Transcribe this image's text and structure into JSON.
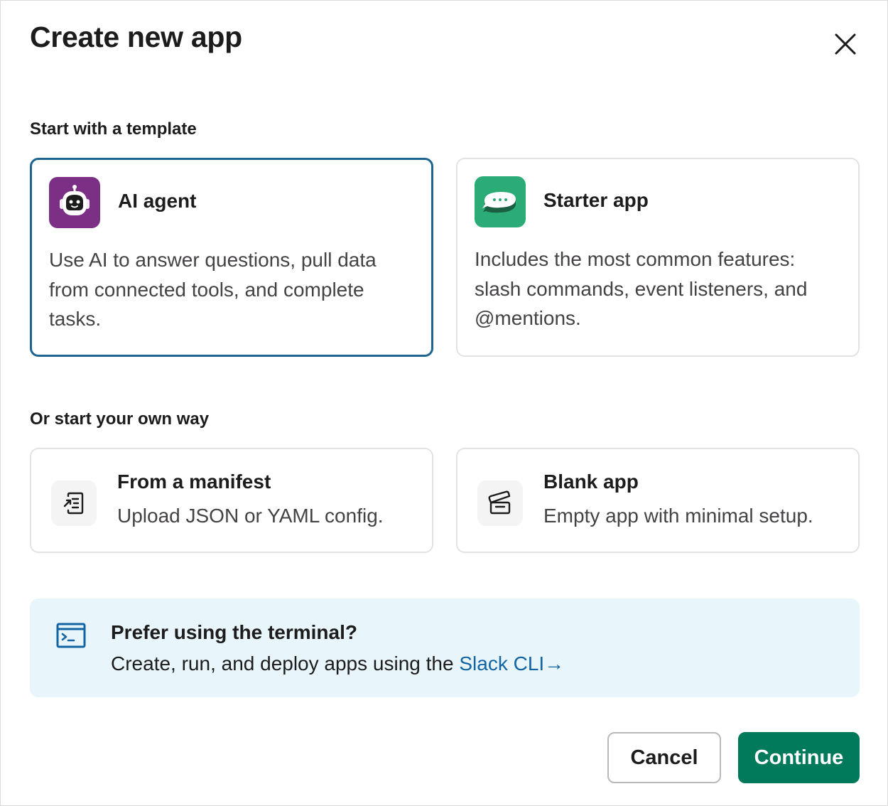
{
  "dialog": {
    "title": "Create new app",
    "close_icon": "close-icon"
  },
  "templates": {
    "section_label": "Start with a template",
    "items": [
      {
        "name": "AI agent",
        "description": "Use AI to answer questions, pull data from connected tools, and complete tasks.",
        "icon": "robot-icon",
        "icon_color": "#7c3085",
        "selected": true
      },
      {
        "name": "Starter app",
        "description": "Includes the most common features: slash commands, event listeners, and @mentions.",
        "icon": "chat-bubble-icon",
        "icon_color": "#2bac76",
        "selected": false
      }
    ]
  },
  "own_way": {
    "section_label": "Or start your own way",
    "items": [
      {
        "name": "From a manifest",
        "description": "Upload JSON or YAML config.",
        "icon": "manifest-icon"
      },
      {
        "name": "Blank app",
        "description": "Empty app with minimal setup.",
        "icon": "clapperboard-icon"
      }
    ]
  },
  "terminal": {
    "title": "Prefer using the terminal?",
    "description": "Create, run, and deploy apps using the",
    "link_label": "Slack CLI",
    "link_arrow": "→",
    "icon": "terminal-icon"
  },
  "footer": {
    "cancel_label": "Cancel",
    "continue_label": "Continue"
  },
  "colors": {
    "selected_border": "#1d6491",
    "continue_button": "#007a5a",
    "link": "#1264a3",
    "terminal_bg": "#e8f5fa"
  }
}
